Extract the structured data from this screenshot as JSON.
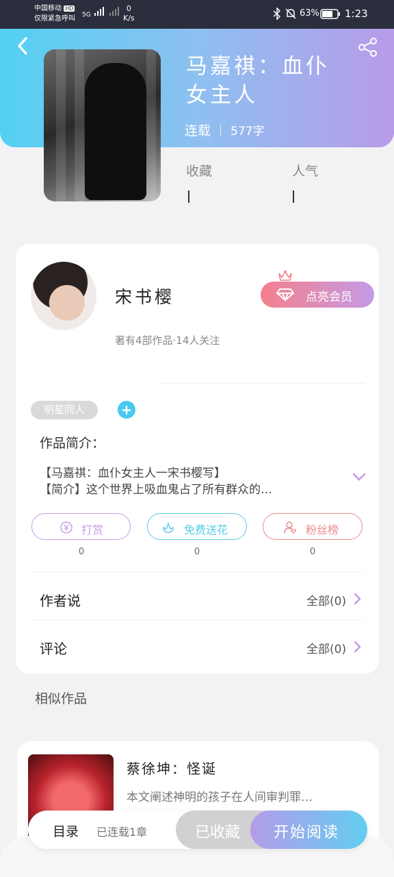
{
  "status_bar": {
    "carrier": "中国移动",
    "hd": "HD",
    "emergency": "仅限紧急呼叫",
    "net": "5G",
    "speed_value": "0",
    "speed_unit": "K/s",
    "battery": "63%",
    "time": "1:23"
  },
  "book": {
    "title": "马嘉祺：血仆女主人",
    "status": "连载",
    "word_count": "577字",
    "stats": [
      {
        "label": "收藏",
        "value": ""
      },
      {
        "label": "人气",
        "value": ""
      }
    ]
  },
  "author": {
    "name": "宋书樱",
    "meta": "著有4部作品·14人关注",
    "vip_label": "点亮会员"
  },
  "tags": [
    "明星同人"
  ],
  "add_tag_symbol": "+",
  "intro": {
    "heading": "作品简介：",
    "line1": "【马嘉祺：血仆女主人一宋书樱写】",
    "line2": "【简介】这个世界上吸血鬼占了所有群众的…"
  },
  "actions": [
    {
      "label": "打赏",
      "count": "0",
      "icon": "coin-icon",
      "color": "#c79ce6"
    },
    {
      "label": "免费送花",
      "count": "0",
      "icon": "flower-icon",
      "color": "#5acbea"
    },
    {
      "label": "粉丝榜",
      "count": "0",
      "icon": "fan-icon",
      "color": "#ef8a8a"
    }
  ],
  "rows": [
    {
      "label": "作者说",
      "right": "全部(0)"
    },
    {
      "label": "评论",
      "right": "全部(0)"
    }
  ],
  "similar": {
    "heading": "相似作品",
    "items": [
      {
        "title": "蔡徐坤：怪诞",
        "desc": "本文阐述神明的孩子在人间审判罪…"
      }
    ]
  },
  "bottom": {
    "toc": "目录",
    "toc_sub": "已连载1章",
    "collected": "已收藏",
    "read": "开始阅读"
  }
}
